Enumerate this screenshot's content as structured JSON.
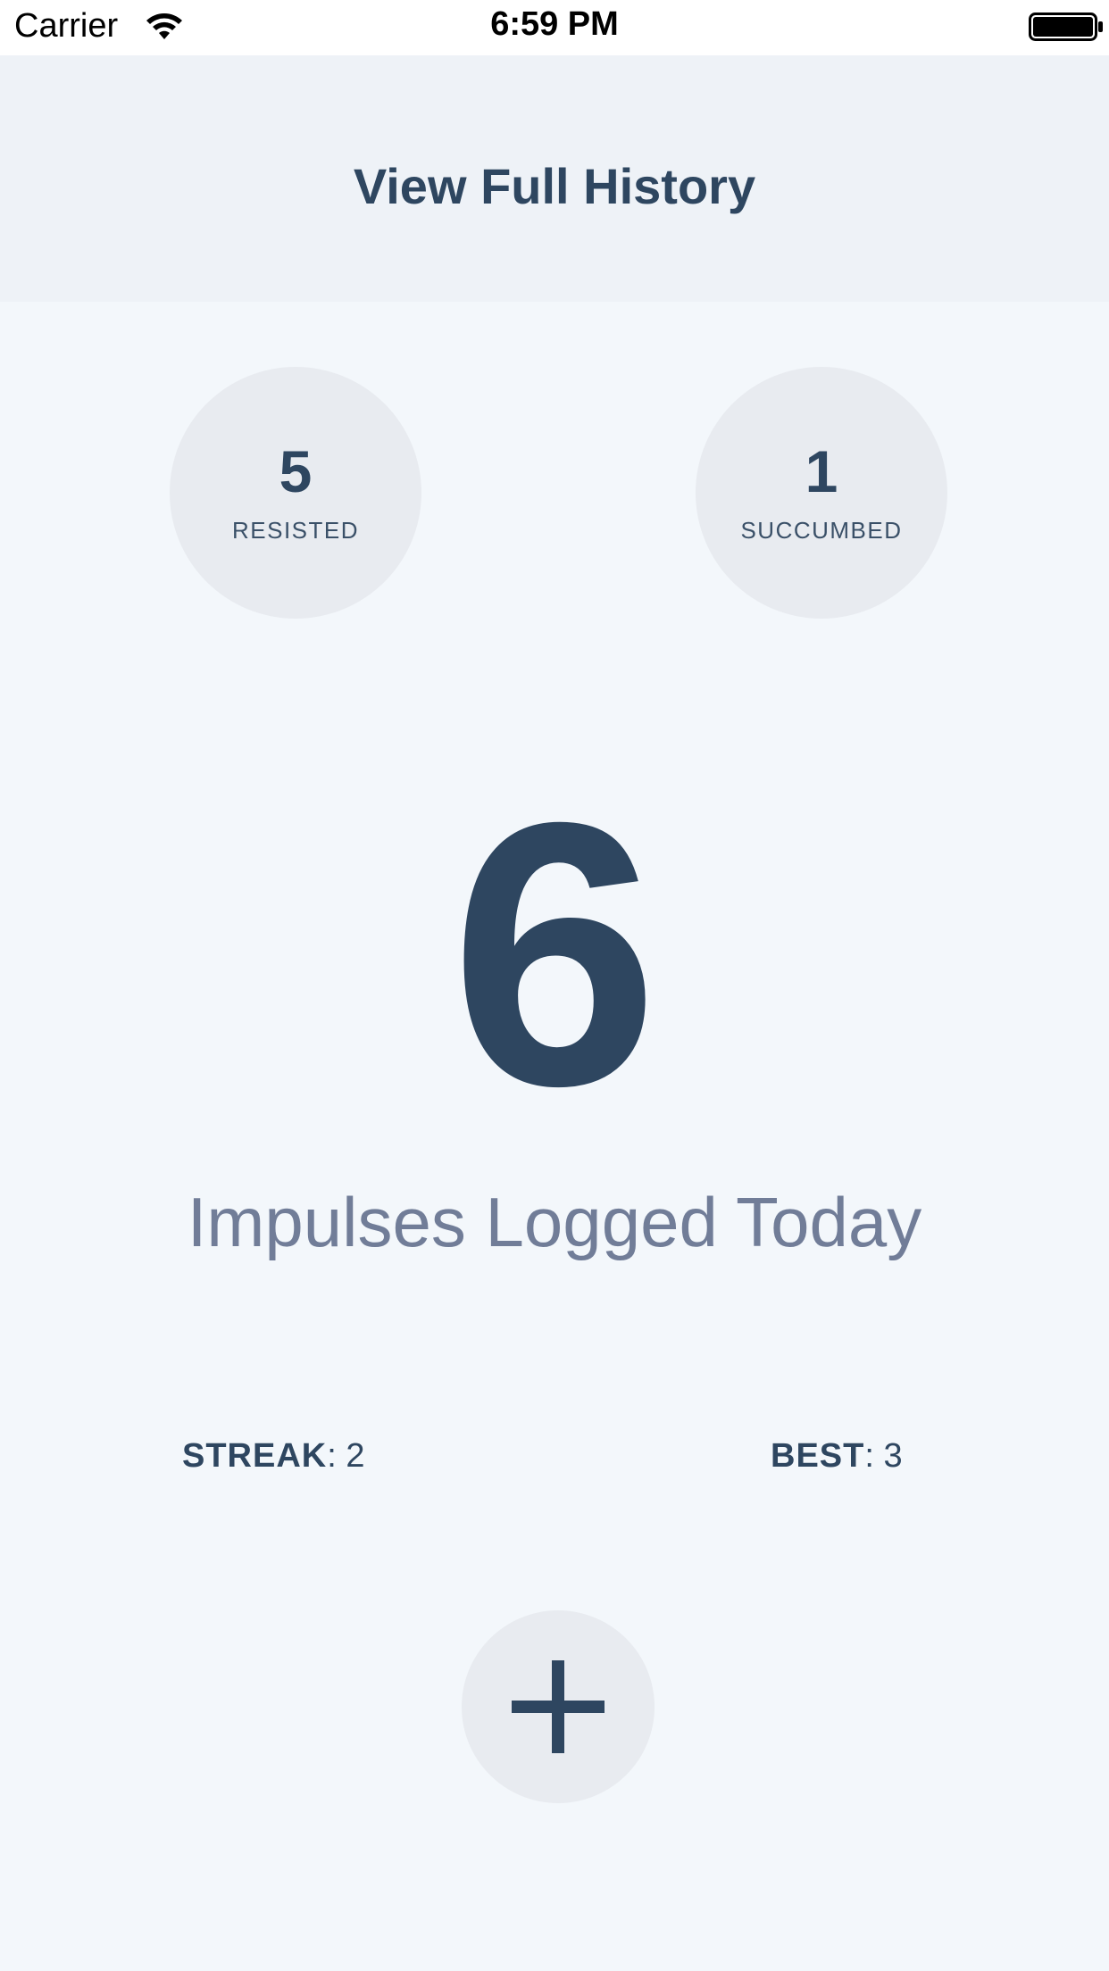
{
  "status_bar": {
    "carrier": "Carrier",
    "time": "6:59 PM",
    "wifi_icon": "wifi-icon",
    "battery_icon": "battery-icon"
  },
  "header": {
    "history_button_label": "View Full History"
  },
  "stats": {
    "resisted": {
      "value": "5",
      "label": "RESISTED"
    },
    "succumbed": {
      "value": "1",
      "label": "SUCCUMBED"
    }
  },
  "total": {
    "count": "6",
    "caption": "Impulses Logged Today"
  },
  "streak": {
    "streak_key": "STREAK",
    "streak_value": ": 2",
    "best_key": "BEST",
    "best_value": ": 3"
  },
  "add_button": {
    "icon": "plus-icon"
  },
  "colors": {
    "primary": "#2e4660",
    "caption": "#717d98",
    "circle": "#e8ebf0",
    "header_bg": "#eef2f7",
    "page_bg": "#f3f7fb"
  }
}
